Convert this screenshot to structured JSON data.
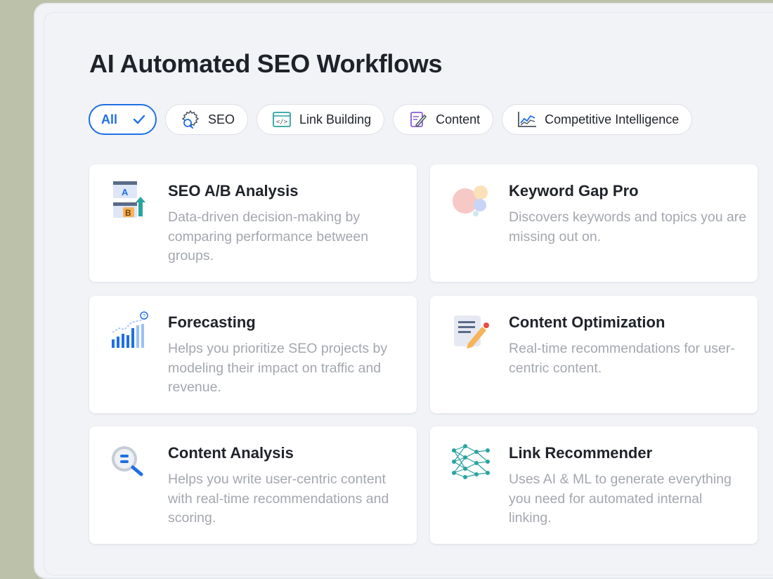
{
  "page": {
    "title": "AI Automated SEO Workflows"
  },
  "filters": [
    {
      "label": "All",
      "icon": "check-icon",
      "active": true
    },
    {
      "label": "SEO",
      "icon": "seo-gear-icon"
    },
    {
      "label": "Link Building",
      "icon": "link-building-icon"
    },
    {
      "label": "Content",
      "icon": "content-edit-icon"
    },
    {
      "label": "Competitive Intelligence",
      "icon": "competitive-chart-icon"
    }
  ],
  "cards": [
    {
      "title": "SEO A/B Analysis",
      "description": "Data-driven decision-making by comparing performance between groups.",
      "icon": "ab-test-icon"
    },
    {
      "title": "Keyword Gap Pro",
      "description": "Discovers keywords and topics you are missing out on.",
      "icon": "keyword-gap-icon"
    },
    {
      "title": "Forecasting",
      "description": "Helps you prioritize SEO projects by modeling their impact on traffic and revenue.",
      "icon": "forecast-chart-icon"
    },
    {
      "title": "Content Optimization",
      "description": "Real-time recommendations for user-centric content.",
      "icon": "document-edit-icon"
    },
    {
      "title": "Content Analysis",
      "description": "Helps you write user-centric content with real-time recommendations and scoring.",
      "icon": "magnifier-icon"
    },
    {
      "title": "Link Recommender",
      "description": "Uses AI & ML to generate everything you need for automated internal linking.",
      "icon": "neural-network-icon"
    }
  ],
  "colors": {
    "accent": "#1f6fe5",
    "title": "#1f2329",
    "muted": "#a3a7ae"
  }
}
